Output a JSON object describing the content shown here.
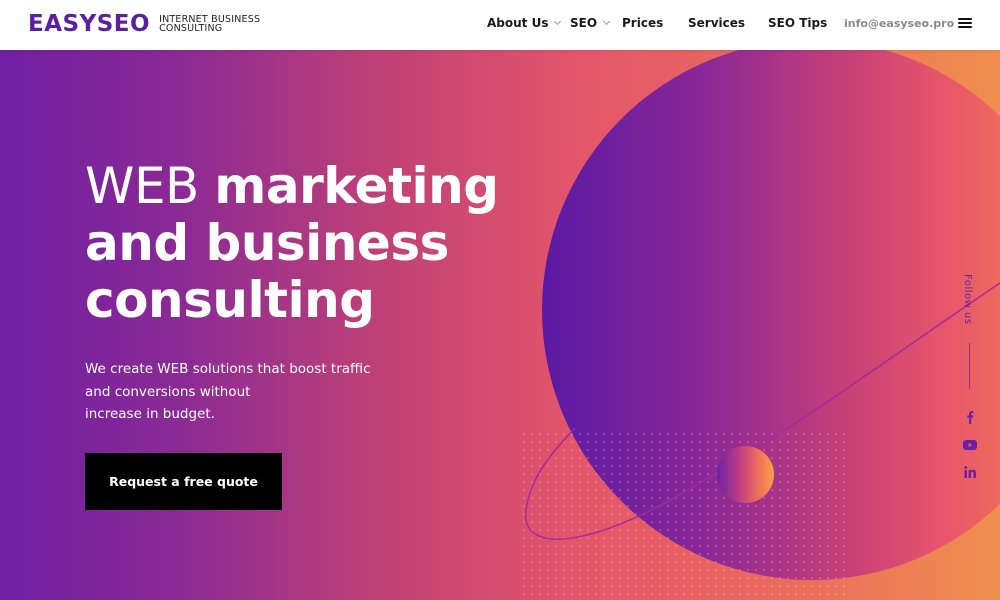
{
  "header": {
    "logo": {
      "name": "EASYSEO",
      "tagline_line1": "INTERNET BUSINESS",
      "tagline_line2": "CONSULTING"
    },
    "nav": [
      {
        "label": "About Us",
        "has_dropdown": true
      },
      {
        "label": "SEO",
        "has_dropdown": true
      },
      {
        "label": "Prices",
        "has_dropdown": false
      },
      {
        "label": "Services",
        "has_dropdown": false
      },
      {
        "label": "SEO Tips",
        "has_dropdown": false
      }
    ],
    "email": "info@easyseo.pro",
    "menu_icon": "hamburger-menu-icon"
  },
  "hero": {
    "headline_thin": "WEB",
    "headline_bold_1": "marketing",
    "headline_bold_2": "and business",
    "headline_bold_3": "consulting",
    "subtext_line1": "We create WEB solutions that boost traffic",
    "subtext_line2": "and conversions without",
    "subtext_line3": "increase in budget.",
    "cta_label": "Request a free quote"
  },
  "social": {
    "follow_label": "Follow us",
    "icons": [
      "facebook-icon",
      "youtube-icon",
      "linkedin-icon"
    ]
  },
  "colors": {
    "brand_purple": "#5b1fa1",
    "gradient_start": "#6f1fa3",
    "gradient_mid": "#e4566a",
    "gradient_end": "#f08f4e",
    "cta_bg": "#000000",
    "social_icon": "#6a1fa8"
  }
}
